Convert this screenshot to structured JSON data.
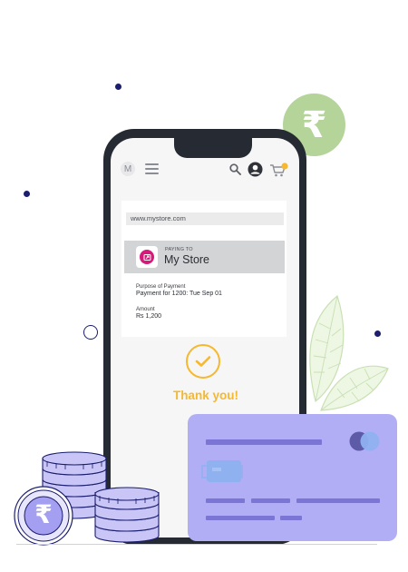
{
  "header": {
    "avatar_letter": "M"
  },
  "payment": {
    "url": "www.mystore.com",
    "paying_to_label": "PAYING TO",
    "store_name": "My Store",
    "purpose_label": "Purpose of Payment",
    "purpose_value": "Payment for 1200: Tue Sep 01",
    "amount_label": "Amount",
    "amount_value": "Rs 1,200"
  },
  "status": {
    "message": "Thank you!"
  },
  "currency_symbol": "₹",
  "colors": {
    "phone_body": "#262b33",
    "success": "#f5b82e",
    "brand_pink": "#d6197a",
    "card": "#b2aef6",
    "bubble": "#b4d49a",
    "coin": "#9f99ee"
  },
  "icons": [
    "menu-icon",
    "search-icon",
    "user-icon",
    "cart-icon",
    "check-icon",
    "store-logo-icon",
    "rupee-icon"
  ]
}
